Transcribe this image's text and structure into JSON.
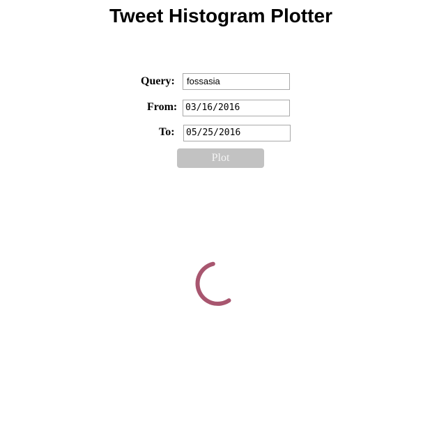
{
  "page": {
    "title": "Tweet Histogram Plotter"
  },
  "form": {
    "query_label": "Query:",
    "query_value": "fossasia",
    "from_label": "From:",
    "from_value": "03/16/2016",
    "to_label": "To:",
    "to_value": "05/25/2016",
    "plot_label": "Plot",
    "plot_disabled": true
  },
  "loading": {
    "indicator": "spinner-icon",
    "color": "#a8566f"
  }
}
